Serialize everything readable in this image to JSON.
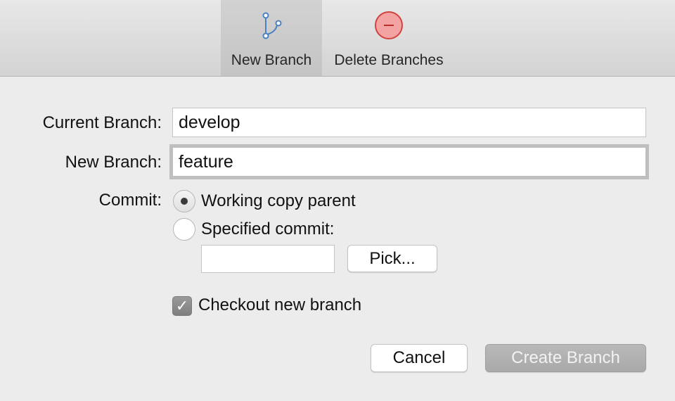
{
  "toolbar": {
    "new_branch": {
      "label": "New Branch",
      "selected": true,
      "icon": "branch-icon"
    },
    "delete_branches": {
      "label": "Delete Branches",
      "icon": "delete-icon"
    }
  },
  "form": {
    "current_branch_label": "Current Branch:",
    "current_branch_value": "develop",
    "new_branch_label": "New Branch:",
    "new_branch_value": "feature",
    "commit_label": "Commit:",
    "options": [
      {
        "label": "Working copy parent",
        "selected": true
      },
      {
        "label": "Specified commit:",
        "selected": false
      }
    ],
    "specified_commit_value": "",
    "pick_button": "Pick...",
    "checkout_label": "Checkout new branch",
    "checkout_checked": true,
    "checkmark": "✓"
  },
  "buttons": {
    "cancel": "Cancel",
    "create": "Create Branch",
    "create_enabled": false
  },
  "colors": {
    "branch_icon": "#4a7fc1",
    "delete_icon_fill": "#f4a3a3",
    "delete_icon_stroke": "#d0433f"
  }
}
